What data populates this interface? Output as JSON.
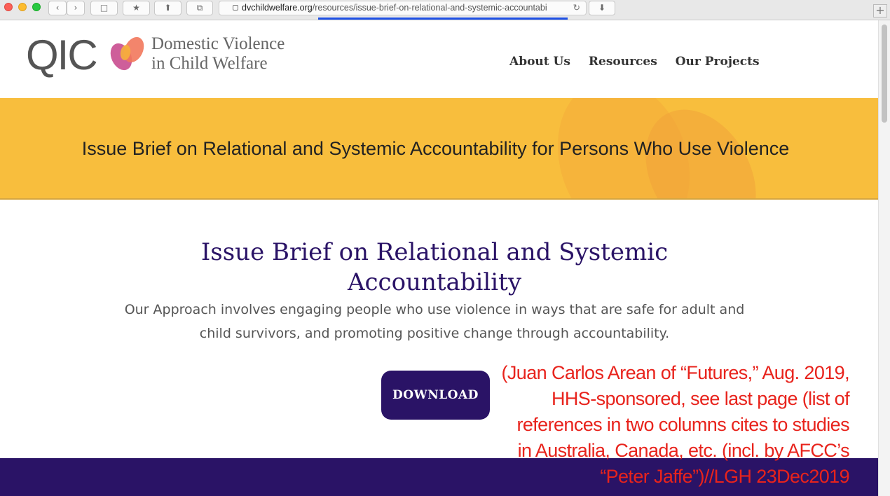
{
  "browser": {
    "url_domain": "dvchildwelfare.org",
    "url_path": "/resources/issue-brief-on-relational-and-systemic-accountabi",
    "plus_label": "+"
  },
  "header": {
    "logo_letters": "QIC",
    "logo_line1": "Domestic Violence",
    "logo_line2": "in Child Welfare",
    "nav": [
      "About Us",
      "Resources",
      "Our Projects"
    ]
  },
  "banner": {
    "title": "Issue Brief on Relational and Systemic Accountability for Persons Who Use Violence"
  },
  "main": {
    "title": "Issue Brief on Relational and Systemic Accountability",
    "description": "Our Approach involves engaging people who use violence in ways that are safe for adult and child survivors, and promoting positive change through accountability.",
    "download_label": "DOWNLOAD"
  },
  "annotation": {
    "text": "(Juan Carlos Arean of “Futures,” Aug. 2019, HHS-sponsored, see last page (list of references in two columns cites to studies in Australia, Canada, etc. (incl. by AFCC’s “Peter Jaffe”)//LGH 23Dec2019"
  },
  "colors": {
    "banner": "#f8be3d",
    "brand_purple": "#2a1366",
    "annotation_red": "#e8231c"
  }
}
